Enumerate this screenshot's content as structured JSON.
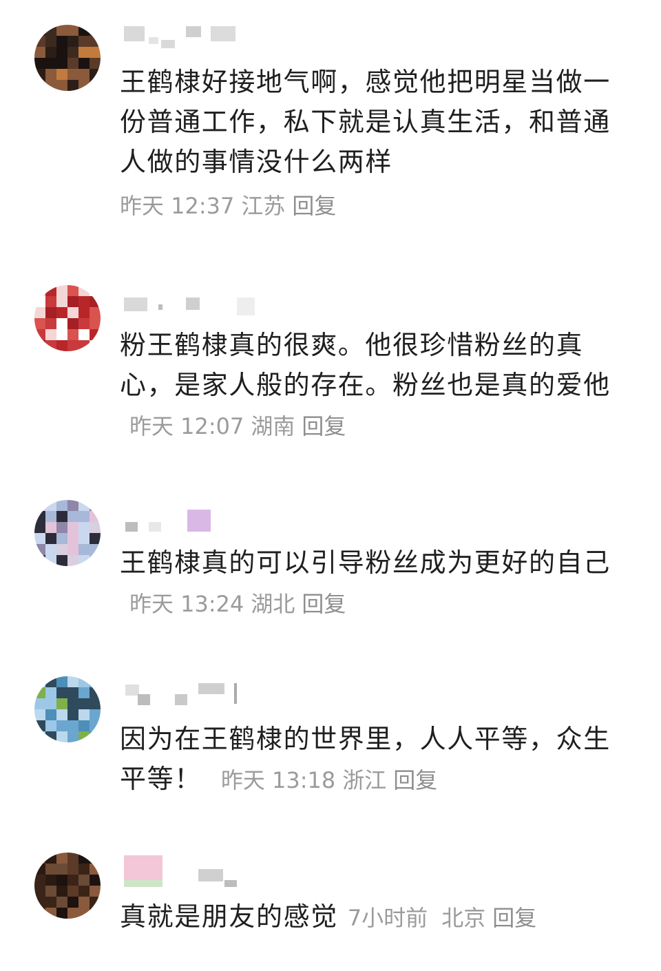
{
  "comments": [
    {
      "text": "王鹤棣好接地气啊，感觉他把明星当做一份普通工作，私下就是认真生活，和普通人做的事情没什么两样",
      "time": "昨天 12:37",
      "location": "江苏",
      "reply_label": "回复",
      "avatar_palette": [
        "#2b1d17",
        "#5a3a28",
        "#c27a3d",
        "#3d2a1f",
        "#8a5a3a",
        "#1a1210"
      ]
    },
    {
      "text": "粉王鹤棣真的很爽。他很珍惜粉丝的真心，是家人般的存在。粉丝也是真的爱他",
      "time": "昨天 12:07",
      "location": "湖南",
      "reply_label": "回复",
      "avatar_palette": [
        "#ffffff",
        "#b9262a",
        "#c93a3c",
        "#d9534f",
        "#a51f24",
        "#f3d6d6"
      ]
    },
    {
      "text": "王鹤棣真的可以引导粉丝成为更好的自己",
      "time": "昨天 13:24",
      "location": "湖北",
      "reply_label": "回复",
      "avatar_palette": [
        "#c9d8ee",
        "#a8b8d8",
        "#e3c3d9",
        "#8f86a8",
        "#d8cfe0",
        "#2c2c3a"
      ]
    },
    {
      "text": "因为在王鹤棣的世界里，人人平等，众生平等！",
      "time": "昨天 13:18",
      "location": "浙江",
      "reply_label": "回复",
      "avatar_palette": [
        "#9cc7e6",
        "#6aa6cf",
        "#4d8fb8",
        "#bcd8ec",
        "#7fb04a",
        "#2e4a5c"
      ]
    },
    {
      "text": "真就是朋友的感觉",
      "time": "7小时前",
      "location": "北京",
      "reply_label": "回复",
      "avatar_palette": [
        "#1c1210",
        "#3a2418",
        "#5c3a28",
        "#8a5a3c",
        "#2a1a12",
        "#6b4a36"
      ]
    }
  ]
}
